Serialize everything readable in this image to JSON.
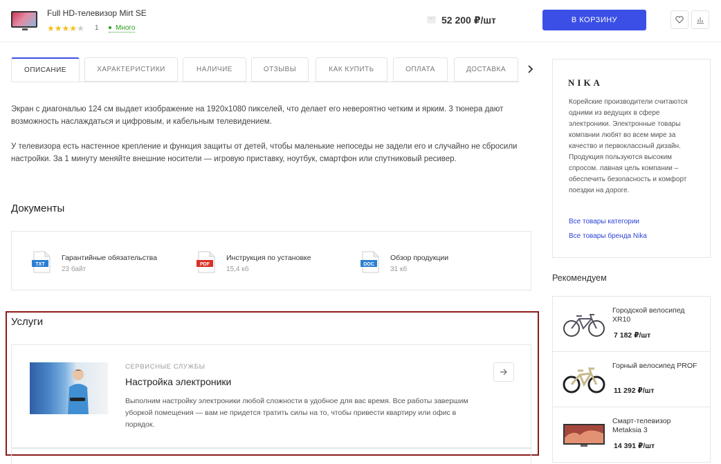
{
  "topbar": {
    "product_title": "Full HD-телевизор Mirt SE",
    "rating_stars": 4,
    "rating_max": 5,
    "rating_count": "1",
    "stock": "Много",
    "more": "···",
    "price": "52 200 ₽/шт",
    "cart_button": "В КОРЗИНУ",
    "icons": [
      "heart-icon",
      "compare-icon"
    ]
  },
  "tabs": [
    {
      "label": "Описание",
      "active": true
    },
    {
      "label": "Характеристики",
      "active": false
    },
    {
      "label": "Наличие",
      "active": false
    },
    {
      "label": "Отзывы",
      "active": false
    },
    {
      "label": "Как купить",
      "active": false
    },
    {
      "label": "Оплата",
      "active": false
    },
    {
      "label": "Доставка",
      "active": false
    }
  ],
  "description": {
    "p1": "Экран с диагональю 124 см выдает изображение на 1920х1080 пикселей, что делает его невероятно четким и ярким. 3 тюнера дают возможность наслаждаться и цифровым, и кабельным телевидением.",
    "p2": "У телевизора есть настенное крепление и функция защиты от детей, чтобы маленькие непоседы не задели его и случайно не сбросили настройки. За 1 минуту меняйте внешние носители — игровую приставку, ноутбук, смартфон или спутниковый ресивер."
  },
  "documents": {
    "title": "Документы",
    "items": [
      {
        "type": "TXT",
        "color": "#2d7fd3",
        "name": "Гарантийные обязательства",
        "size": "23 байт"
      },
      {
        "type": "PDF",
        "color": "#d93025",
        "name": "Инструкция по установке",
        "size": "15,4 кб"
      },
      {
        "type": "DOC",
        "color": "#2d7fd3",
        "name": "Обзор продукции",
        "size": "31 кб"
      }
    ]
  },
  "services": {
    "title": "Услуги",
    "card": {
      "category": "Сервисные службы",
      "title": "Настройка электроники",
      "text": "Выполним настройку электроники любой сложности в удобное для вас время. Все работы завершим уборкой помещения — вам не придется тратить силы на то, чтобы привести квартиру или офис в порядок."
    }
  },
  "brand": {
    "logo": "NIKA",
    "text": "Корейские производители считаются одними из ведущих в сфере электроники. Электронные товары компании любят во всем мире за качество и первоклассный дизайн. Продукция пользуются высоким спросом. лавная цель компании – обеспечить безопасность и комфорт поездки на дороге.",
    "link_category": "Все товары категории",
    "link_brand": "Все товары бренда Nika"
  },
  "recommend": {
    "title": "Рекомендуем",
    "items": [
      {
        "name": "Городской велосипед XR10",
        "price": "7 182 ₽/шт"
      },
      {
        "name": "Горный велосипед PROF",
        "price": "11 292 ₽/шт"
      },
      {
        "name": "Смарт-телевизор Metaksia 3",
        "price": "14 391 ₽/шт"
      }
    ]
  },
  "colors": {
    "accent": "#3b4fe6",
    "highlight_frame": "#8b1a1a",
    "star": "#f4c01e",
    "stock": "#2a9d1d"
  }
}
